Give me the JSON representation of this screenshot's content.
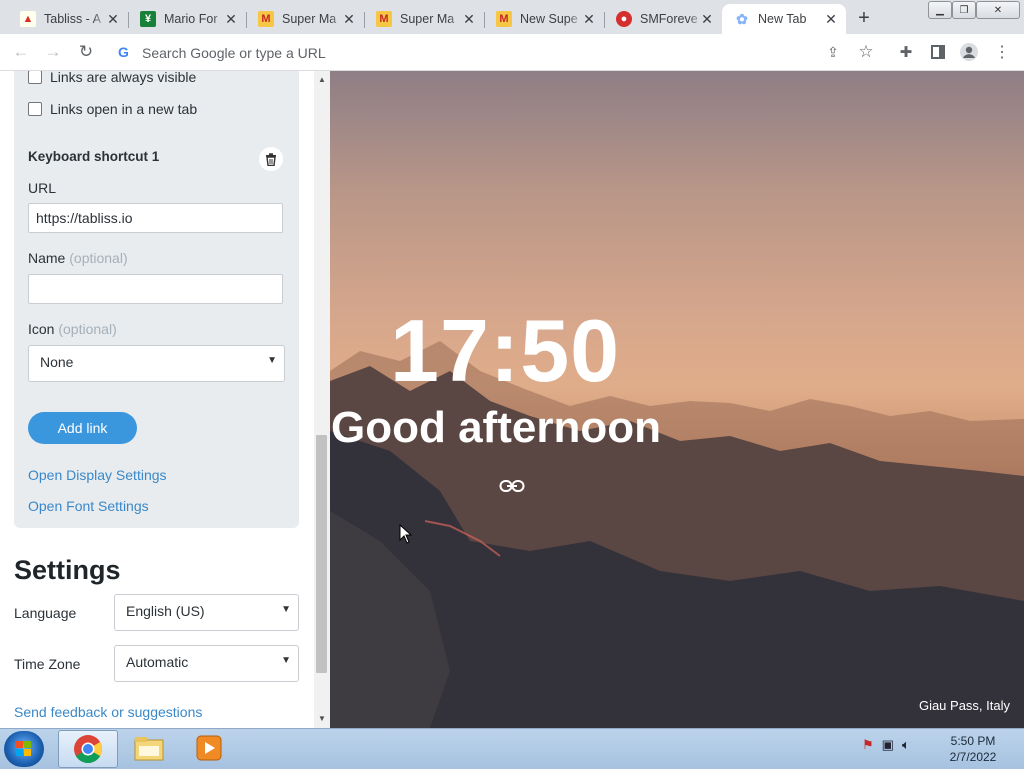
{
  "browser": {
    "tabs": [
      {
        "title": "Tabliss - A",
        "favicon": "tabliss-icon",
        "active": false
      },
      {
        "title": "Mario For",
        "favicon": "sheets-icon",
        "active": false
      },
      {
        "title": "Super Ma",
        "favicon": "mario-icon",
        "active": false
      },
      {
        "title": "Super Ma",
        "favicon": "mario-icon",
        "active": false
      },
      {
        "title": "New Supe",
        "favicon": "mario-icon",
        "active": false
      },
      {
        "title": "SMForeve",
        "favicon": "smforever-icon",
        "active": false
      },
      {
        "title": "New Tab",
        "favicon": "newtab-icon",
        "active": true
      }
    ],
    "new_tab_symbol": "+",
    "omnibox_placeholder": "Search Google or type a URL",
    "colors": {
      "tabstrip": "#dee1e6",
      "toolbar": "#ffffff"
    }
  },
  "links_widget": {
    "always_visible_label": "Links are always visible",
    "always_visible_checked": false,
    "new_tab_label": "Links open in a new tab",
    "new_tab_checked": false,
    "shortcut_heading": "Keyboard shortcut 1",
    "url_label": "URL",
    "url_value": "https://tabliss.io",
    "name_label": "Name",
    "optional_text": "(optional)",
    "name_value": "",
    "icon_label": "Icon",
    "icon_value": "None",
    "add_link_label": "Add link",
    "open_display_label": "Open Display Settings",
    "open_font_label": "Open Font Settings"
  },
  "settings": {
    "title": "Settings",
    "language_label": "Language",
    "language_value": "English (US)",
    "timezone_label": "Time Zone",
    "timezone_value": "Automatic",
    "feedback_label": "Send feedback or suggestions"
  },
  "dashboard": {
    "time": "17:50",
    "greeting": "Good afternoon",
    "photo_credit": "Giau Pass, Italy"
  },
  "taskbar": {
    "clock_time": "5:50 PM",
    "clock_date": "2/7/2022",
    "apps": [
      "chrome-icon",
      "file-explorer-icon",
      "media-player-icon"
    ],
    "accent": "#3b97dd"
  }
}
